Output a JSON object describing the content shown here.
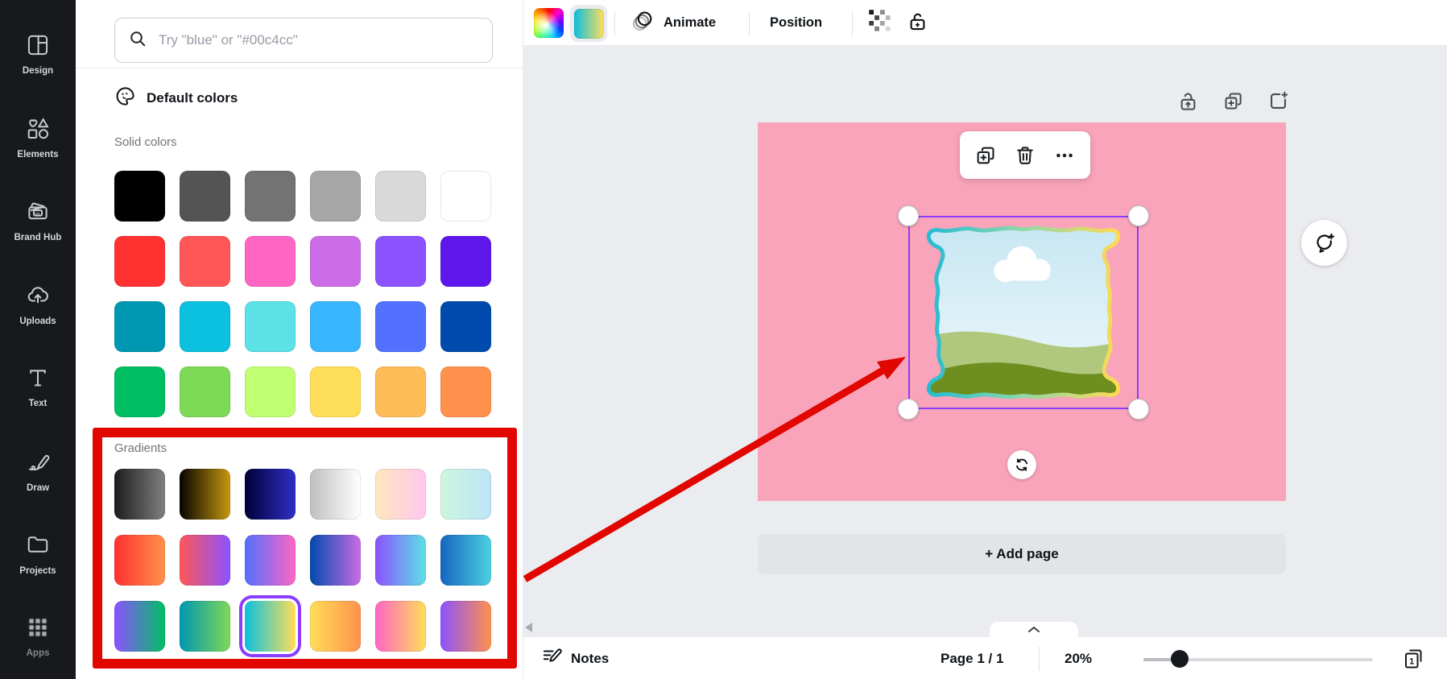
{
  "sidebar": {
    "items": [
      {
        "id": "design",
        "label": "Design"
      },
      {
        "id": "elements",
        "label": "Elements"
      },
      {
        "id": "brand-hub",
        "label": "Brand Hub"
      },
      {
        "id": "uploads",
        "label": "Uploads"
      },
      {
        "id": "text",
        "label": "Text"
      },
      {
        "id": "draw",
        "label": "Draw"
      },
      {
        "id": "projects",
        "label": "Projects"
      },
      {
        "id": "apps",
        "label": "Apps"
      }
    ]
  },
  "color_panel": {
    "search_placeholder": "Try \"blue\" or \"#00c4cc\"",
    "header": "Default colors",
    "solid_label": "Solid colors",
    "gradients_label": "Gradients",
    "solid_colors": [
      "#000000",
      "#545454",
      "#737373",
      "#a6a6a6",
      "#d9d9d9",
      "#ffffff",
      "#ff3131",
      "#ff5757",
      "#ff66c4",
      "#cb6ce6",
      "#8c52ff",
      "#5e17eb",
      "#0097b2",
      "#0cc0df",
      "#5ce1e6",
      "#38b6ff",
      "#5271ff",
      "#004aad",
      "#00bf63",
      "#7ed957",
      "#c1ff72",
      "#ffde59",
      "#ffbd59",
      "#ff914d"
    ],
    "gradients": [
      {
        "from": "#1c1c1c",
        "to": "#808080"
      },
      {
        "from": "#050300",
        "to": "#c79810"
      },
      {
        "from": "#00003a",
        "to": "#2f2fc5"
      },
      {
        "from": "#bfbfbf",
        "to": "#ffffff"
      },
      {
        "from": "#ffe8bd",
        "to": "#ffc7ee"
      },
      {
        "from": "#cdf6de",
        "to": "#bde4f7"
      },
      {
        "from": "#ff3131",
        "to": "#ff914d"
      },
      {
        "from": "#ff5757",
        "to": "#8c52ff"
      },
      {
        "from": "#5170ff",
        "to": "#ff66c4"
      },
      {
        "from": "#004aad",
        "to": "#cb6ce6"
      },
      {
        "from": "#8c52ff",
        "to": "#5ce1e6"
      },
      {
        "from": "#1565c0",
        "to": "#4dd0e1"
      },
      {
        "from": "#8c52ff",
        "to": "#00bf63"
      },
      {
        "from": "#0097b2",
        "to": "#7ed957"
      },
      {
        "from": "#0cc0df",
        "to": "#ffde59",
        "selected": true
      },
      {
        "from": "#ffde59",
        "to": "#ff914d"
      },
      {
        "from": "#ff66c4",
        "to": "#ffde59"
      },
      {
        "from": "#8c52ff",
        "to": "#ff914d"
      }
    ]
  },
  "top_toolbar": {
    "animate_label": "Animate",
    "position_label": "Position",
    "selected_gradient": {
      "from": "#0cc0df",
      "to": "#ffde59"
    }
  },
  "canvas": {
    "add_page_label": "+ Add page"
  },
  "bottom_bar": {
    "notes_label": "Notes",
    "page_indicator": "Page 1 / 1",
    "zoom_level": "20%",
    "page_badge": "1"
  },
  "accents": {
    "selection_purple": "#8b3dff",
    "annotation_red": "#e10600",
    "canvas_pink": "#f9a4ba"
  }
}
